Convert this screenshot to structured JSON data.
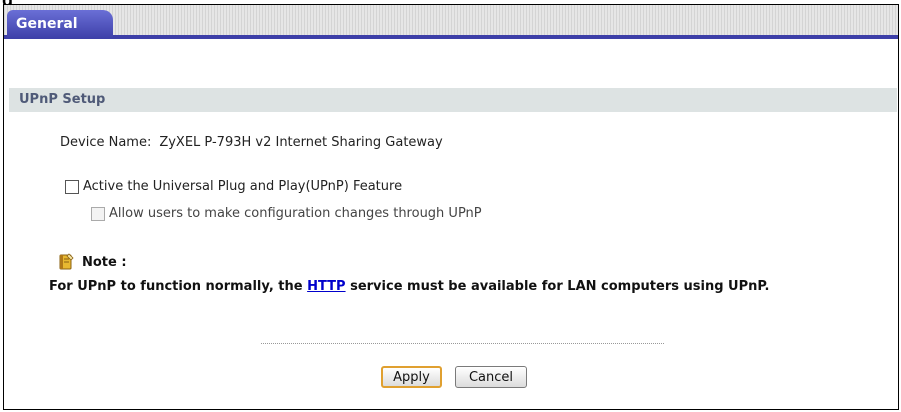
{
  "tabs": [
    {
      "label": "General",
      "active": true
    }
  ],
  "section": {
    "title": "UPnP Setup"
  },
  "device": {
    "label": "Device Name:",
    "value": "ZyXEL P-793H v2 Internet Sharing Gateway"
  },
  "options": {
    "upnp_enable": {
      "label": "Active the Universal Plug and Play(UPnP) Feature",
      "checked": false
    },
    "allow_config": {
      "label": "Allow users to make configuration changes through UPnP",
      "checked": false,
      "disabled": true
    }
  },
  "note": {
    "title": "Note :",
    "text_before": "For UPnP to function normally, the ",
    "link": "HTTP",
    "text_after": " service must be available for LAN computers using UPnP."
  },
  "buttons": {
    "apply": "Apply",
    "cancel": "Cancel"
  },
  "colors": {
    "tab": "#3d3fa8",
    "section_header_bg": "#dde3e3",
    "section_header_text": "#4f5a78",
    "apply_border": "#e0a030",
    "link": "#0000cc"
  }
}
